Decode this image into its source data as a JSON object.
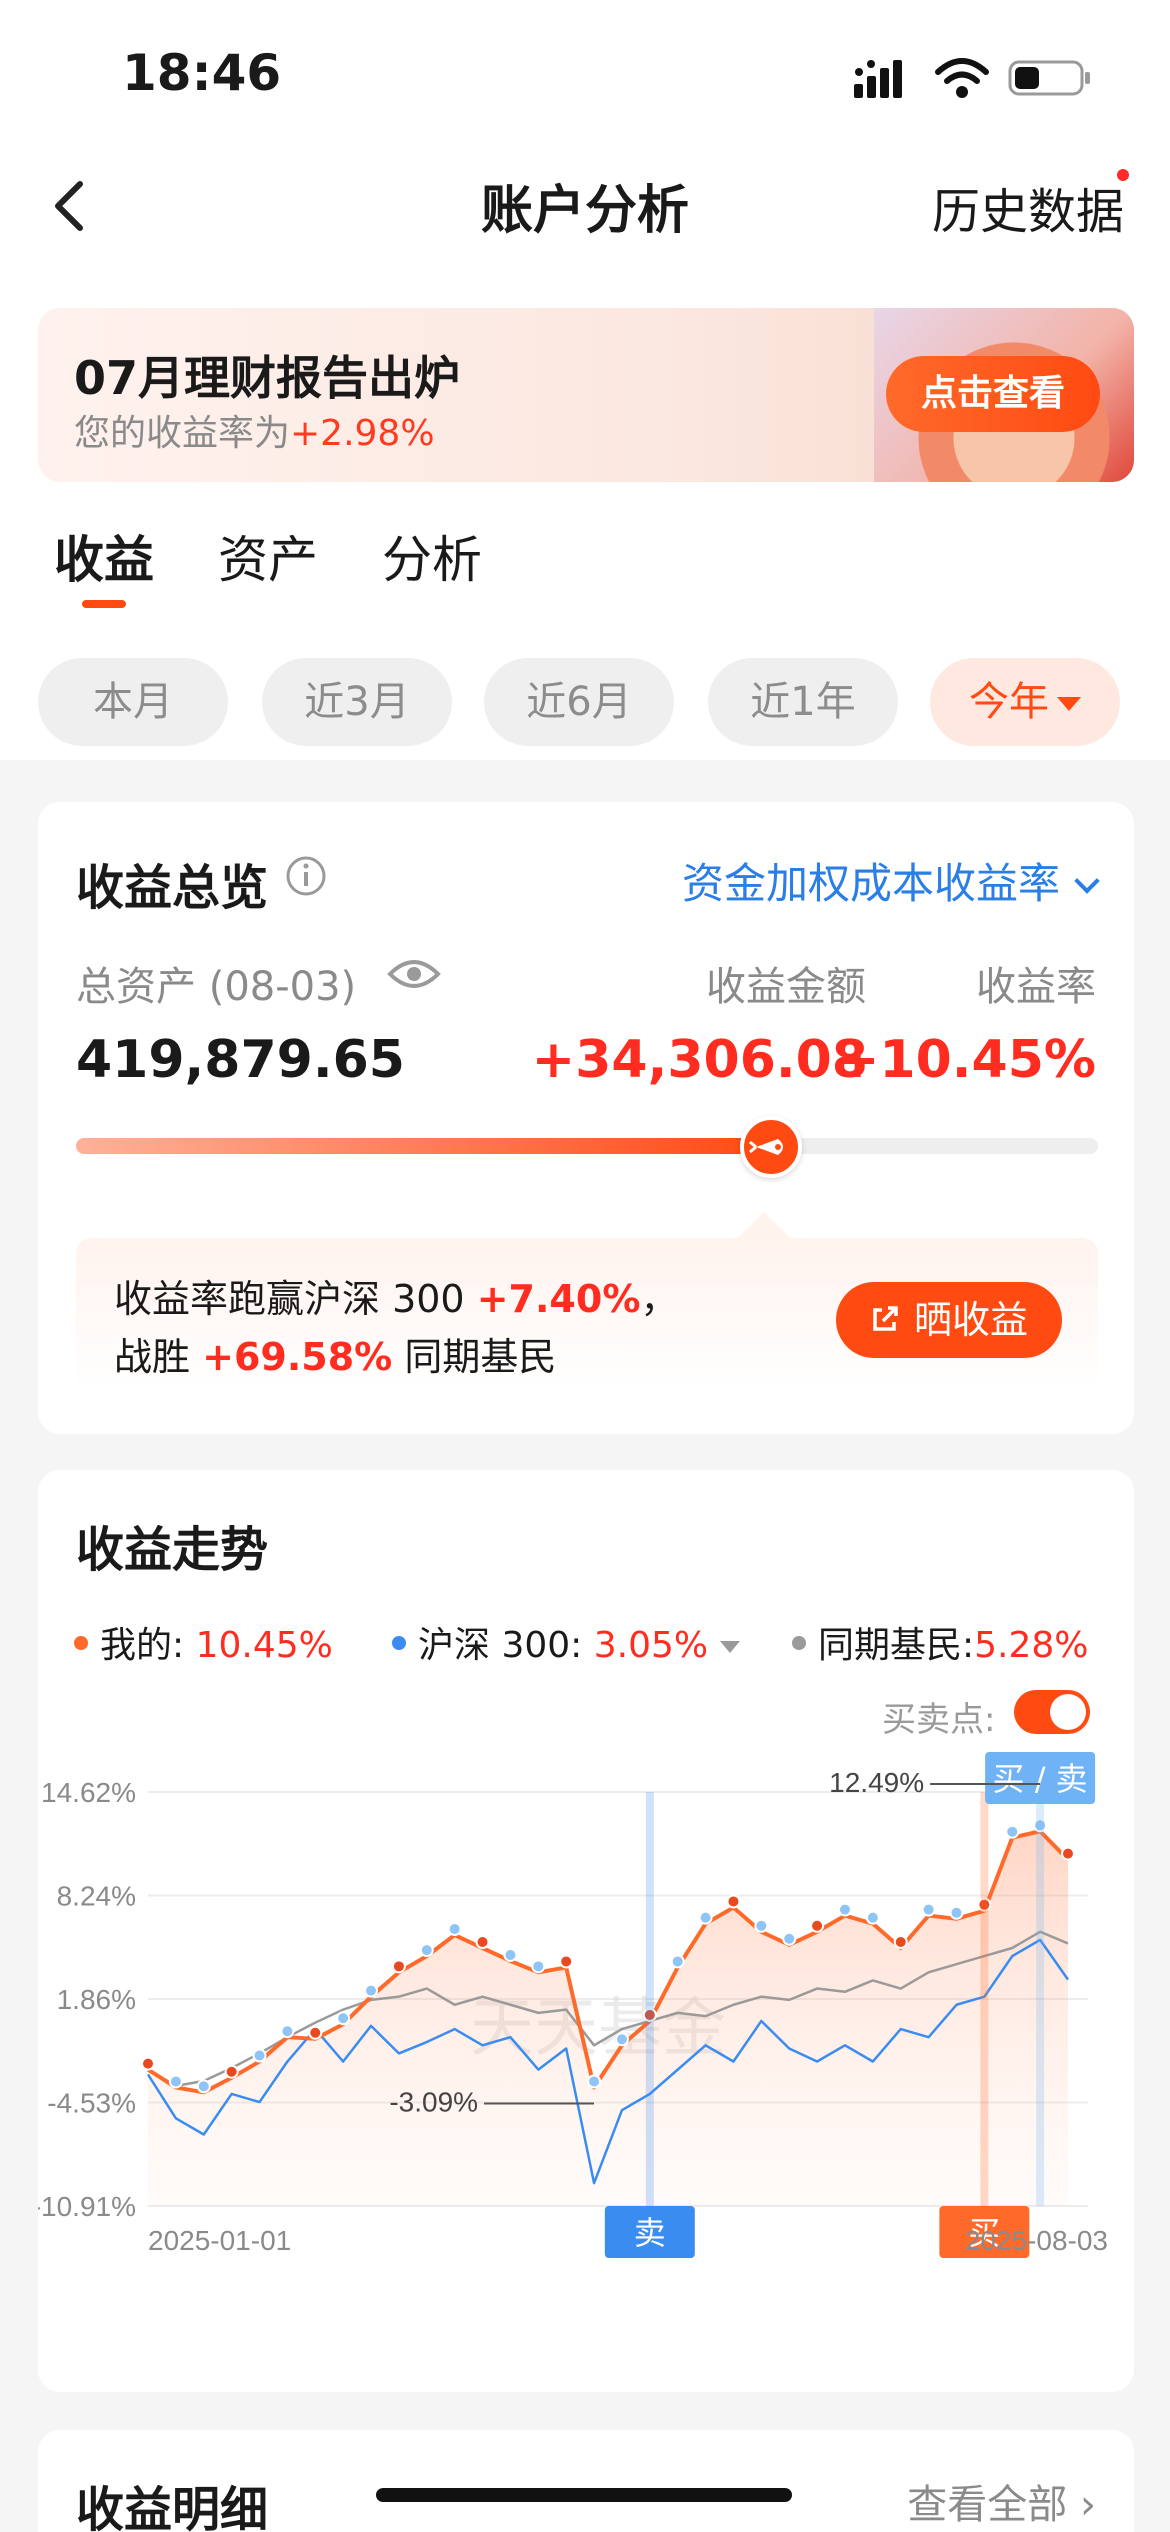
{
  "status_bar": {
    "time": "18:46"
  },
  "nav": {
    "title": "账户分析",
    "history_label": "历史数据"
  },
  "banner": {
    "title": "07月理财报告出炉",
    "subtitle_prefix": "您的收益率为",
    "subtitle_rate": "+2.98%",
    "button_label": "点击查看"
  },
  "tabs": [
    {
      "label": "收益",
      "active": true
    },
    {
      "label": "资产",
      "active": false
    },
    {
      "label": "分析",
      "active": false
    }
  ],
  "period_chips": [
    {
      "label": "本月",
      "active": false
    },
    {
      "label": "近3月",
      "active": false
    },
    {
      "label": "近6月",
      "active": false
    },
    {
      "label": "近1年",
      "active": false
    },
    {
      "label": "今年",
      "active": true
    }
  ],
  "overview": {
    "title": "收益总览",
    "rate_type": "资金加权成本收益率",
    "total_assets_label": "总资产 (08-03)",
    "total_assets_value": "419,879.65",
    "profit_label": "收益金额",
    "profit_value": "+34,306.08",
    "rate_label": "收益率",
    "rate_value": "+10.45%",
    "progress_fraction": 0.68,
    "compare_line1_prefix": "收益率跑赢沪深 300",
    "compare_line1_value": "+7.40%",
    "compare_line1_suffix": "，",
    "compare_line2_prefix": "战胜",
    "compare_line2_value": "+69.58%",
    "compare_line2_suffix": "同期基民",
    "share_button": "晒收益"
  },
  "trend": {
    "title": "收益走势",
    "legend": [
      {
        "label": "我的:",
        "value": "10.45%",
        "color": "#ff6a2a"
      },
      {
        "label": "沪深 300:",
        "value": "3.05%",
        "color": "#3b8cf0"
      },
      {
        "label": "同期基民:",
        "value": "5.28%",
        "color": "#9a9a9a"
      }
    ],
    "buy_sell_label": "买卖点:",
    "buy_sell_on": true
  },
  "chart_data": {
    "type": "line",
    "x_start_label": "2025-01-01",
    "x_end_label": "2025-08-03",
    "y_ticks": [
      "14.62%",
      "8.24%",
      "1.86%",
      "-4.53%",
      "-10.91%"
    ],
    "ylim": [
      -10.91,
      14.62
    ],
    "series": [
      {
        "name": "我的",
        "color": "#ff6a2a",
        "values": [
          -2.5,
          -3.6,
          -3.9,
          -3.0,
          -2.0,
          -0.5,
          -0.6,
          0.3,
          2.0,
          3.5,
          4.5,
          5.8,
          5.0,
          4.2,
          3.5,
          3.8,
          -3.6,
          -1.0,
          0.5,
          3.8,
          6.5,
          7.5,
          6.0,
          5.2,
          6.0,
          7.0,
          6.5,
          5.0,
          7.0,
          6.8,
          7.3,
          11.8,
          12.2,
          10.45
        ]
      },
      {
        "name": "沪深 300",
        "color": "#3b8cf0",
        "values": [
          -2.8,
          -5.5,
          -6.5,
          -4.0,
          -4.5,
          -2.0,
          0.0,
          -2.0,
          0.2,
          -1.5,
          -0.8,
          0.0,
          -1.0,
          -0.5,
          -2.5,
          -1.2,
          -9.5,
          -5.0,
          -4.0,
          -2.5,
          -1.0,
          -2.0,
          0.5,
          -1.2,
          -2.0,
          -1.0,
          -2.0,
          0.0,
          -0.5,
          1.5,
          2.0,
          4.5,
          5.5,
          3.05
        ]
      },
      {
        "name": "同期基民",
        "color": "#9a9a9a",
        "values": [
          -2.5,
          -3.5,
          -3.2,
          -2.4,
          -1.5,
          -0.5,
          0.4,
          1.2,
          1.8,
          2.0,
          2.5,
          1.5,
          2.0,
          1.5,
          1.0,
          1.2,
          -1.0,
          0.0,
          0.5,
          1.0,
          0.8,
          1.5,
          2.0,
          1.8,
          2.5,
          2.3,
          3.0,
          2.5,
          3.5,
          4.0,
          4.5,
          5.0,
          6.0,
          5.28
        ]
      }
    ],
    "annotations": [
      {
        "text": "12.49%",
        "index": 32
      },
      {
        "text": "-3.09%",
        "index": 16
      }
    ],
    "markers": [
      {
        "text": "卖",
        "index": 18,
        "color": "#3b8cf0"
      },
      {
        "text": "买",
        "index": 30,
        "color": "#ff6a2a"
      },
      {
        "text": "买 / 卖",
        "index": 32,
        "color": "#6fb2f5"
      }
    ],
    "watermark": "天天基金"
  },
  "detail": {
    "title": "收益明细",
    "see_all": "查看全部"
  }
}
